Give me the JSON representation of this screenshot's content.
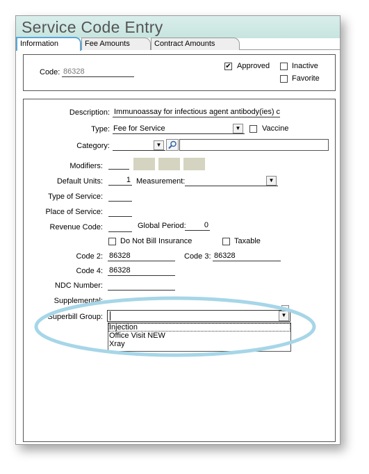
{
  "window": {
    "title": "Service Code Entry"
  },
  "tabs": [
    {
      "label": "Information"
    },
    {
      "label": "Fee Amounts"
    },
    {
      "label": "Contract Amounts"
    }
  ],
  "header": {
    "code_label": "Code:",
    "code_value": "86328",
    "approved_label": "Approved",
    "approved_checked": "✔",
    "inactive_label": "Inactive",
    "favorite_label": "Favorite"
  },
  "form": {
    "description_label": "Description:",
    "description_value": "Immunoassay for infectious agent antibody(ies)  c",
    "type_label": "Type:",
    "type_value": "Fee for Service",
    "vaccine_label": "Vaccine",
    "category_label": "Category:",
    "modifiers_label": "Modifiers:",
    "default_units_label": "Default Units:",
    "default_units_value": "1",
    "measurement_label": "Measurement:",
    "type_of_service_label": "Type of Service:",
    "place_of_service_label": "Place of Service:",
    "revenue_code_label": "Revenue Code:",
    "global_period_label": "Global Period:",
    "global_period_value": "0",
    "do_not_bill_label": "Do Not Bill Insurance",
    "taxable_label": "Taxable",
    "code2_label": "Code 2:",
    "code2_value": "86328",
    "code3_label": "Code 3:",
    "code3_value": "86328",
    "code4_label": "Code 4:",
    "code4_value": "86328",
    "ndc_label": "NDC Number:",
    "supplemental_label": "Supplemental:",
    "superbill_label": "Superbill Group:",
    "superbill_value": "",
    "superbill_options": [
      "Injection",
      "Office Visit NEW",
      "Xray"
    ]
  },
  "icons": {
    "search": "magnifier-icon",
    "dropdown": "chevron-down-icon"
  },
  "colors": {
    "title_bar": "#c7e4df",
    "active_tab_border": "#5aa8d8",
    "highlight_ellipse": "#9fd3e6"
  }
}
